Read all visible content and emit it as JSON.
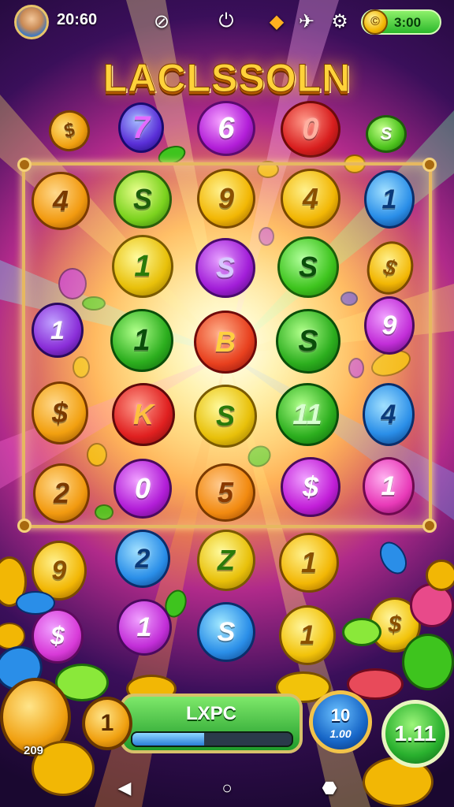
{
  "top_bar": {
    "time": "20:60",
    "coin_balance": "3:00",
    "icons": [
      "avatar",
      "no-sign-icon",
      "power-icon",
      "pizza-icon",
      "rocket-icon",
      "gear-icon",
      "coin-icon"
    ]
  },
  "title": "LACLSSOLN",
  "top_row": [
    {
      "symbol": "7",
      "color": "#5a2fd8"
    },
    {
      "symbol": "6",
      "color": "#b21ed8"
    },
    {
      "symbol": "0",
      "color": "#d81e1e"
    }
  ],
  "board": {
    "rows": [
      [
        {
          "symbol": "4",
          "color": "#f29a10"
        },
        {
          "symbol": "S",
          "color": "#7bd21e"
        },
        {
          "symbol": "9",
          "color": "#f2b705"
        },
        {
          "symbol": "4",
          "color": "#f2b705"
        },
        {
          "symbol": "1",
          "color": "#2a8ee8"
        }
      ],
      [
        {
          "symbol": "1",
          "color": "#e8c00a"
        },
        {
          "symbol": "S",
          "color": "#a21ed8"
        },
        {
          "symbol": "S",
          "color": "#3ec41e"
        }
      ],
      [
        {
          "symbol": "1",
          "color": "#8a2ed8"
        },
        {
          "symbol": "1",
          "color": "#2cae1e"
        },
        {
          "symbol": "B",
          "color": "#e8401e"
        },
        {
          "symbol": "S",
          "color": "#2cae1e"
        },
        {
          "symbol": "9",
          "color": "#c22ed8"
        }
      ],
      [
        {
          "symbol": "$",
          "color": "#f2a010"
        },
        {
          "symbol": "K",
          "color": "#e02020"
        },
        {
          "symbol": "S",
          "color": "#e8c00a"
        },
        {
          "symbol": "11",
          "color": "#2cae1e"
        },
        {
          "symbol": "4",
          "color": "#2a8ee8"
        }
      ],
      [
        {
          "symbol": "2",
          "color": "#f29a10"
        },
        {
          "symbol": "0",
          "color": "#b21ed8"
        },
        {
          "symbol": "5",
          "color": "#f28a10"
        },
        {
          "symbol": "$",
          "color": "#c21ed8"
        },
        {
          "symbol": "1",
          "color": "#e83ab8"
        }
      ]
    ]
  },
  "below_row_1": [
    {
      "symbol": "9",
      "color": "#f2b705"
    },
    {
      "symbol": "2",
      "color": "#2a8ee8"
    },
    {
      "symbol": "Z",
      "color": "#e8c00a"
    },
    {
      "symbol": "1",
      "color": "#f2b705"
    }
  ],
  "below_row_2": [
    {
      "symbol": "$",
      "color": "#d83ad8"
    },
    {
      "symbol": "1",
      "color": "#c22ed8"
    },
    {
      "symbol": "S",
      "color": "#2a8ee8"
    },
    {
      "symbol": "1",
      "color": "#f2c30a"
    },
    {
      "symbol": "$",
      "color": "#f2c30a"
    }
  ],
  "bottom": {
    "level": "1",
    "xp_label": "LXPC",
    "xp_progress": 0.45,
    "badge_top": "10",
    "badge_sub": "1.00",
    "green_badge": "1.11",
    "small_value": "209"
  },
  "nav": {
    "back": "◀",
    "home": "○",
    "recents": "⬣"
  }
}
